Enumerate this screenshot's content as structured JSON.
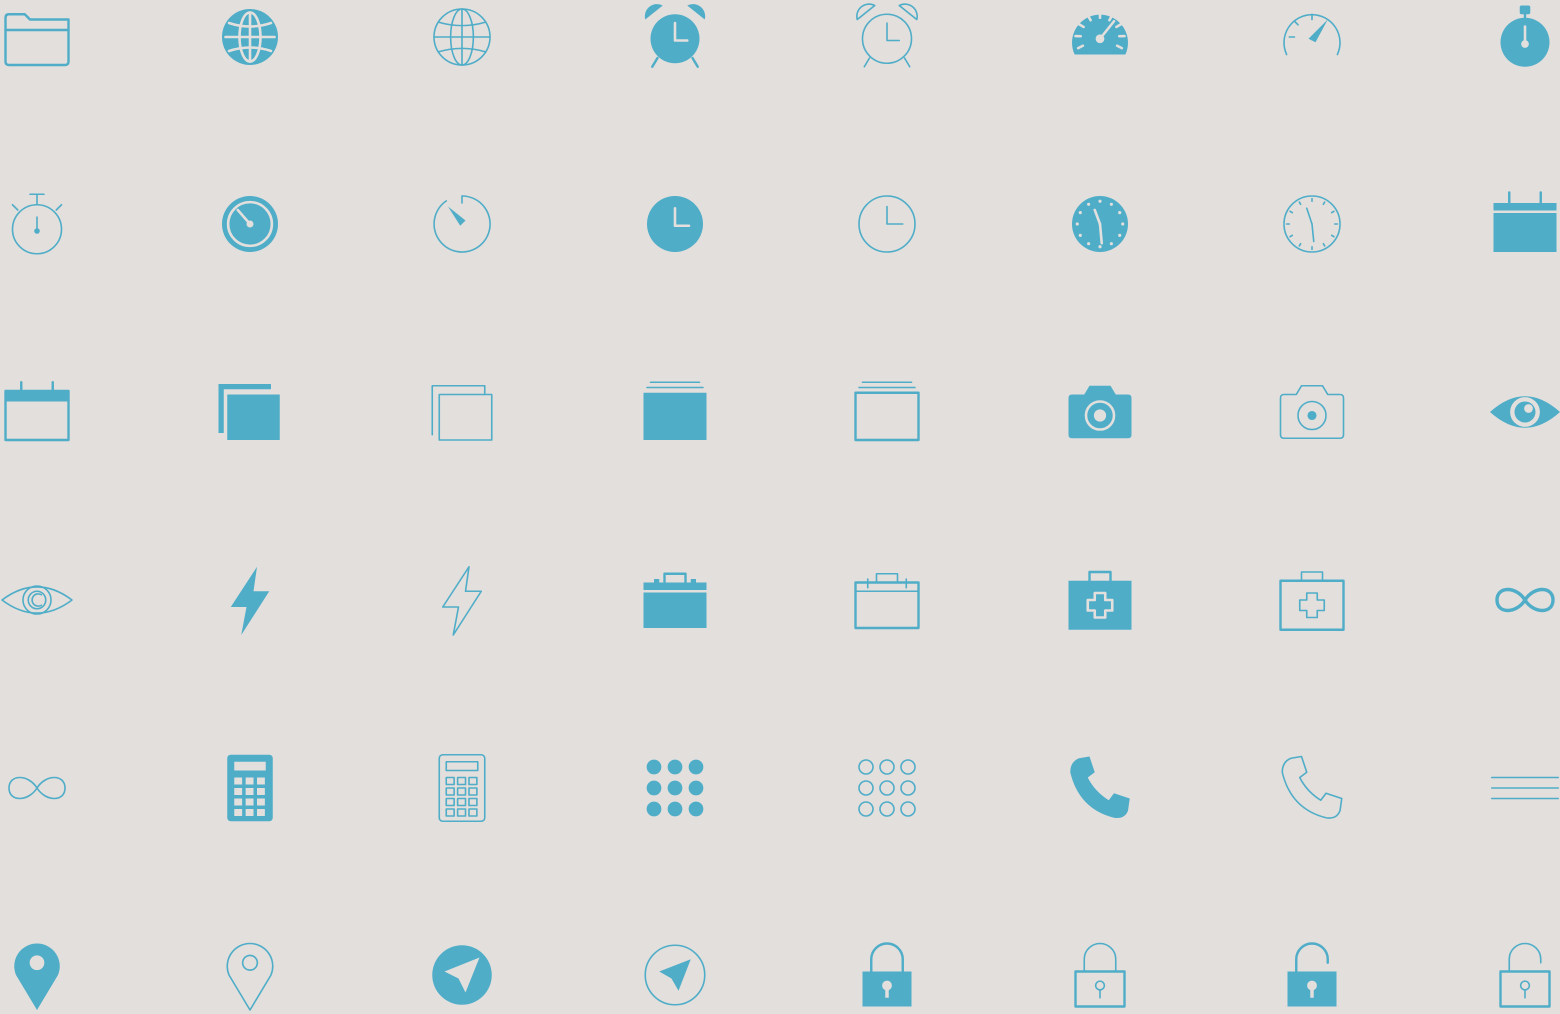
{
  "colors": {
    "background": "#e2dfdd",
    "accent": "#4fadc8"
  },
  "icons": [
    [
      "folder-outline",
      "globe-filled",
      "globe-outline",
      "alarm-clock-filled",
      "alarm-clock-outline",
      "speedometer-filled",
      "speedometer-outline",
      "stopwatch-filled"
    ],
    [
      "stopwatch-outline",
      "timer-filled",
      "timer-outline",
      "clock-filled",
      "clock-outline",
      "watch-face-filled",
      "watch-face-outline",
      "calendar-filled"
    ],
    [
      "calendar-outline",
      "stacked-windows-filled",
      "stacked-windows-outline",
      "folder-stack-filled",
      "folder-stack-outline",
      "camera-filled",
      "camera-outline",
      "eye-filled"
    ],
    [
      "eye-outline",
      "lightning-filled",
      "lightning-outline",
      "toolbox-filled",
      "toolbox-outline",
      "first-aid-kit-filled",
      "first-aid-kit-outline",
      "infinity-filled"
    ],
    [
      "infinity-outline",
      "calculator-filled",
      "calculator-outline",
      "dots-grid-filled",
      "dots-grid-outline",
      "phone-filled",
      "phone-outline",
      "menu-lines"
    ],
    [
      "map-pin-filled",
      "map-pin-outline",
      "navigation-arrow-filled",
      "navigation-arrow-outline",
      "padlock-locked-filled",
      "padlock-locked-outline",
      "padlock-unlocked-filled",
      "padlock-unlocked-outline"
    ]
  ]
}
